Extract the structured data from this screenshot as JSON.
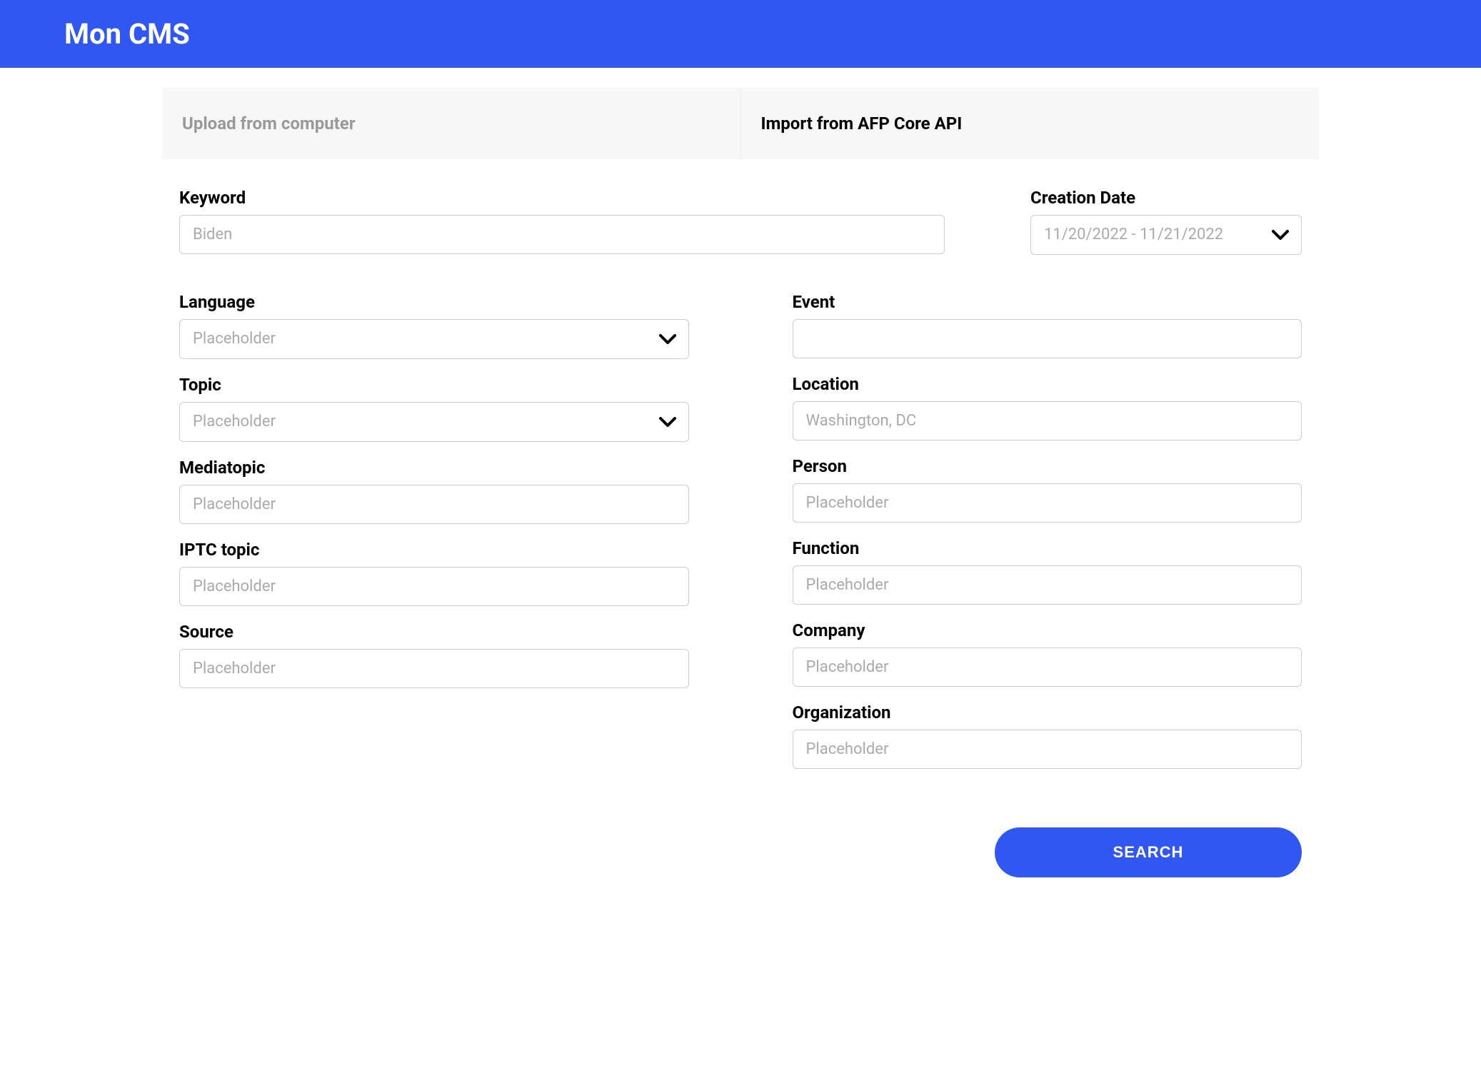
{
  "header": {
    "title": "Mon CMS"
  },
  "tabs": {
    "upload": "Upload from computer",
    "import": "Import from AFP Core API"
  },
  "form": {
    "keyword": {
      "label": "Keyword",
      "placeholder": "Biden"
    },
    "creation_date": {
      "label": "Creation Date",
      "value": "11/20/2022 - 11/21/2022"
    },
    "language": {
      "label": "Language",
      "placeholder": "Placeholder"
    },
    "topic": {
      "label": "Topic",
      "placeholder": "Placeholder"
    },
    "mediatopic": {
      "label": "Mediatopic",
      "placeholder": "Placeholder"
    },
    "iptc_topic": {
      "label": "IPTC topic",
      "placeholder": "Placeholder"
    },
    "source": {
      "label": "Source",
      "placeholder": "Placeholder"
    },
    "event": {
      "label": "Event",
      "placeholder": ""
    },
    "location": {
      "label": "Location",
      "placeholder": "Washington, DC"
    },
    "person": {
      "label": "Person",
      "placeholder": "Placeholder"
    },
    "function": {
      "label": "Function",
      "placeholder": "Placeholder"
    },
    "company": {
      "label": "Company",
      "placeholder": "Placeholder"
    },
    "organization": {
      "label": "Organization",
      "placeholder": "Placeholder"
    }
  },
  "buttons": {
    "search": "Search"
  }
}
